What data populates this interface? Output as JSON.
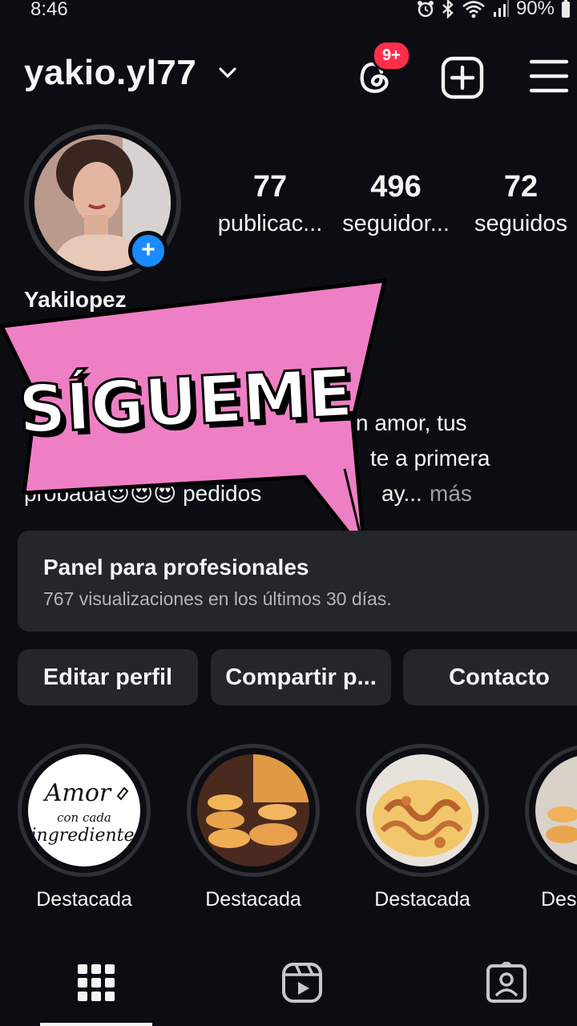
{
  "status": {
    "time": "8:46",
    "battery": "90%"
  },
  "header": {
    "username": "yakio.yl77",
    "threads_badge": "9+"
  },
  "profile": {
    "display_name": "Yakilopez",
    "stats": [
      {
        "value": "77",
        "label": "publicac..."
      },
      {
        "value": "496",
        "label": "seguidor..."
      },
      {
        "value": "72",
        "label": "seguidos"
      }
    ]
  },
  "bio": {
    "line1": "n amor,  tus",
    "line2": "te a primera",
    "line3": "probada😍😍😍 pedidos",
    "line3_tail": "ay...",
    "more": "más"
  },
  "sticker": {
    "text": "SÍGUEME",
    "color": "#ee7fc4"
  },
  "pro_panel": {
    "title": "Panel para profesionales",
    "subtitle": "767 visualizaciones en los últimos 30 días."
  },
  "buttons": {
    "edit": "Editar perfil",
    "share": "Compartir p...",
    "contact": "Contacto"
  },
  "highlights": [
    {
      "label": "Destacada",
      "art_text_1": "Amor",
      "art_text_2": "con cada",
      "art_text_3": "ingrediente"
    },
    {
      "label": "Destacada"
    },
    {
      "label": "Destacada"
    },
    {
      "label": "Des"
    }
  ],
  "icons": {
    "threads": "threads-icon",
    "add": "add-post-icon",
    "menu": "hamburger-menu-icon",
    "grid": "grid-icon",
    "reels": "reels-icon",
    "tagged": "tagged-icon"
  },
  "colors": {
    "background": "#0c0d12",
    "panel": "#25262c",
    "accent_blue": "#1a8cff",
    "badge_red": "#ff2e4c"
  }
}
